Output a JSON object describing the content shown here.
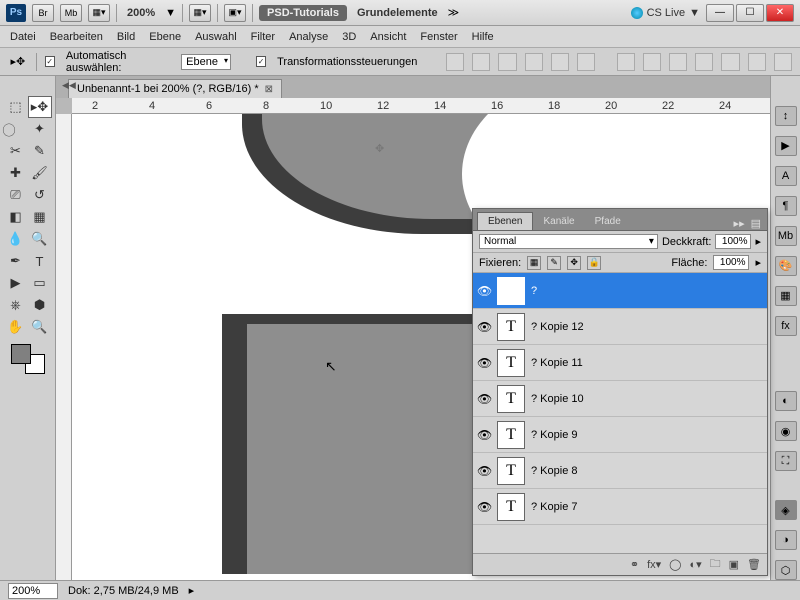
{
  "titlebar": {
    "app": "Ps",
    "btns": [
      "Br",
      "Mb"
    ],
    "zoom": "200%",
    "group1": "PSD-Tutorials",
    "group2": "Grundelemente",
    "cslive": "CS Live"
  },
  "menu": [
    "Datei",
    "Bearbeiten",
    "Bild",
    "Ebene",
    "Auswahl",
    "Filter",
    "Analyse",
    "3D",
    "Ansicht",
    "Fenster",
    "Hilfe"
  ],
  "optbar": {
    "auto_label": "Automatisch auswählen:",
    "auto_value": "Ebene",
    "transform_label": "Transformationssteuerungen"
  },
  "doc": {
    "tab_title": "Unbenannt-1 bei 200% (?, RGB/16) *",
    "ruler_marks": [
      "2",
      "4",
      "6",
      "8",
      "10",
      "12",
      "14",
      "16",
      "18",
      "20",
      "22",
      "24"
    ]
  },
  "layers": {
    "tabs": [
      "Ebenen",
      "Kanäle",
      "Pfade"
    ],
    "blend": "Normal",
    "opacity_label": "Deckkraft:",
    "opacity": "100%",
    "lock_label": "Fixieren:",
    "fill_label": "Fläche:",
    "fill": "100%",
    "items": [
      {
        "name": "?",
        "sel": true
      },
      {
        "name": "? Kopie 12",
        "sel": false
      },
      {
        "name": "? Kopie 11",
        "sel": false
      },
      {
        "name": "? Kopie 10",
        "sel": false
      },
      {
        "name": "? Kopie 9",
        "sel": false
      },
      {
        "name": "? Kopie 8",
        "sel": false
      },
      {
        "name": "? Kopie 7",
        "sel": false
      }
    ]
  },
  "status": {
    "zoom": "200%",
    "doc": "Dok: 2,75 MB/24,9 MB"
  }
}
